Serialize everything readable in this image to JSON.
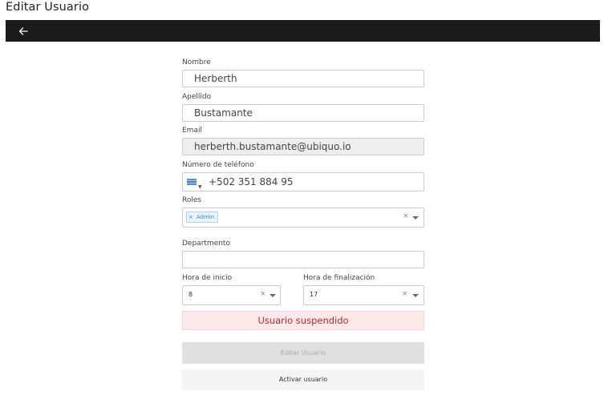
{
  "page": {
    "title": "Editar Usuario"
  },
  "toolbar": {
    "back_icon": "arrow-left-icon"
  },
  "form": {
    "nombre": {
      "label": "Nombre",
      "value": "Herberth"
    },
    "apellido": {
      "label": "Apellido",
      "value": "Bustamante"
    },
    "email": {
      "label": "Email",
      "value": "herberth.bustamante@ubiquo.io"
    },
    "telefono": {
      "label": "Número de teléfono",
      "value": "+502 351 884 95",
      "country_flag": "guatemala-flag-icon"
    },
    "roles": {
      "label": "Roles",
      "tags": [
        {
          "remove": "×",
          "label": "Admin"
        }
      ],
      "clear": "×"
    },
    "departamento": {
      "label": "Departmento",
      "value": ""
    },
    "hora_inicio": {
      "label": "Hora de inicio",
      "value": "8",
      "clear": "×"
    },
    "hora_fin": {
      "label": "Hora de finalización",
      "value": "17",
      "clear": "×"
    }
  },
  "status": {
    "suspended_text": "Usuario suspendido",
    "color": "#c0282c",
    "background": "#fde8ea"
  },
  "actions": {
    "edit_label": "Editar Usuario",
    "activate_label": "Activar usuario"
  },
  "colors": {
    "toolbar": "#1a1a1a",
    "tag_text": "#3a8bc7"
  }
}
